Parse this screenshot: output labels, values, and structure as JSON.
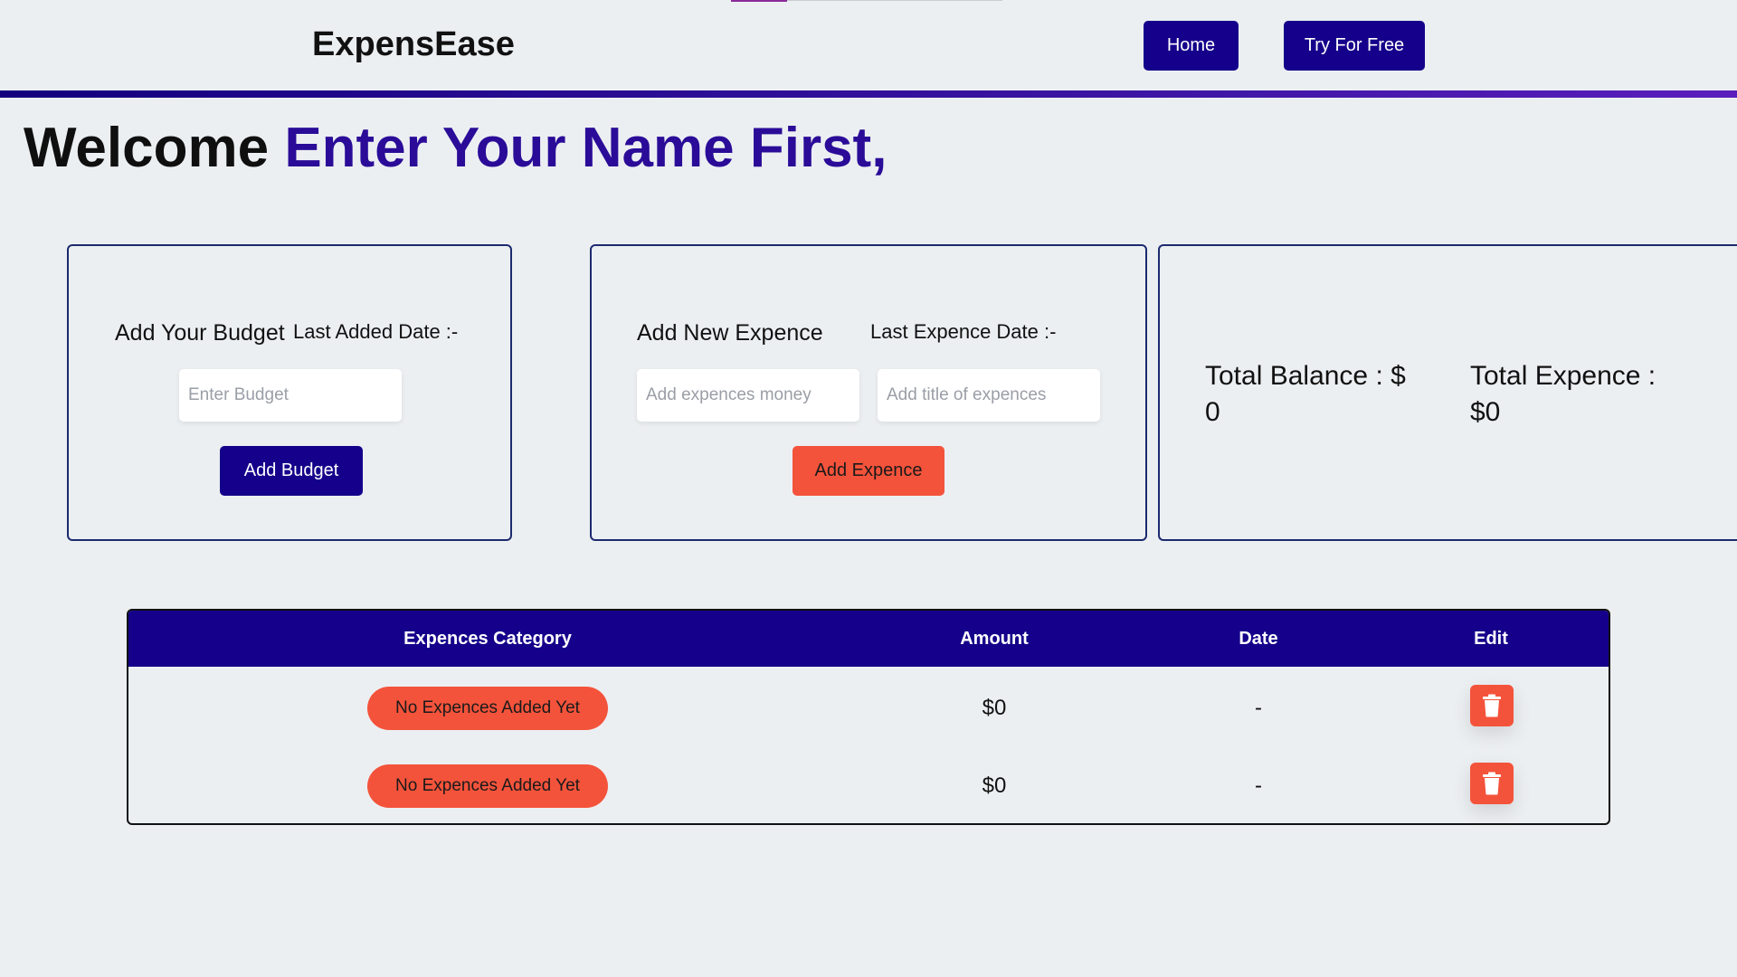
{
  "nav": {
    "brand": "ExpensEase",
    "home_label": "Home",
    "try_label": "Try For Free"
  },
  "welcome": {
    "prefix": "Welcome",
    "name": "Enter Your Name First,"
  },
  "budget_card": {
    "title": "Add Your Budget",
    "last_date_label": "Last Added Date :-",
    "input_placeholder": "Enter Budget",
    "button_label": "Add Budget"
  },
  "expense_card": {
    "title": "Add New Expence",
    "last_date_label": "Last Expence Date :-",
    "money_placeholder": "Add expences money",
    "title_placeholder": "Add title of expences",
    "button_label": "Add Expence"
  },
  "totals_card": {
    "balance_label": "Total Balance : $",
    "balance_value": "0",
    "expense_label": "Total Expence :",
    "expense_value": "$0"
  },
  "table": {
    "headers": [
      "Expences Category",
      "Amount",
      "Date",
      "Edit"
    ],
    "rows": [
      {
        "category": "No Expences Added Yet",
        "amount": "$0",
        "date": "-",
        "edit_icon": "trash-icon"
      },
      {
        "category": "No Expences Added Yet",
        "amount": "$0",
        "date": "-",
        "edit_icon": "trash-icon"
      }
    ]
  },
  "colors": {
    "primary": "#14008a",
    "accent": "#f4533b",
    "name_highlight": "#2a0c98",
    "background": "#eceff2"
  }
}
